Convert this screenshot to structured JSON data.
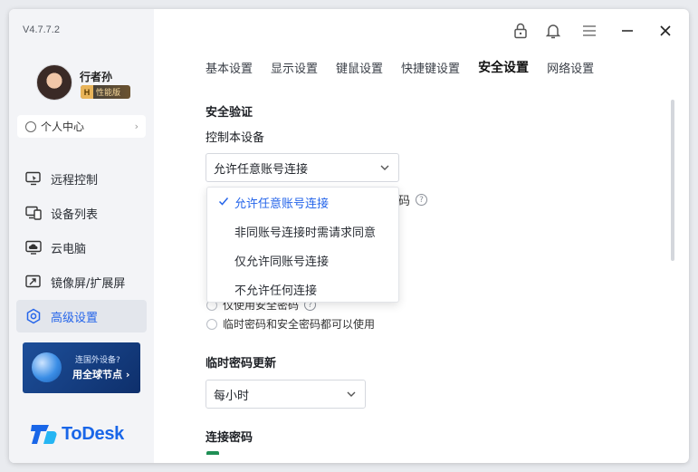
{
  "app": {
    "version": "V4.7.7.2",
    "brand": "ToDesk",
    "accent": "#2565ea"
  },
  "user": {
    "name": "行者孙",
    "badge_letter": "H",
    "badge_text": "性能版"
  },
  "personal_center": {
    "label": "个人中心"
  },
  "sidebar": {
    "items": [
      {
        "label": "远程控制",
        "icon": "remote-control-icon"
      },
      {
        "label": "设备列表",
        "icon": "device-list-icon"
      },
      {
        "label": "云电脑",
        "icon": "cloud-pc-icon"
      },
      {
        "label": "镜像屏/扩展屏",
        "icon": "mirror-screen-icon"
      },
      {
        "label": "高级设置",
        "icon": "advanced-settings-icon"
      }
    ]
  },
  "promo": {
    "line1": "连国外设备?",
    "line2": "用全球节点 ›"
  },
  "tabs": [
    {
      "label": "基本设置"
    },
    {
      "label": "显示设置"
    },
    {
      "label": "键鼠设置"
    },
    {
      "label": "快捷键设置"
    },
    {
      "label": "安全设置",
      "active": true
    },
    {
      "label": "网络设置"
    }
  ],
  "security": {
    "section_title": "安全验证",
    "control_label": "控制本设备",
    "control_value": "允许任意账号连接",
    "dropdown_options": [
      {
        "label": "允许任意账号连接",
        "selected": true
      },
      {
        "label": "非同账号连接时需请求同意"
      },
      {
        "label": "仅允许同账号连接"
      },
      {
        "label": "不允许任何连接"
      }
    ],
    "hidden_suffix": "码",
    "radio_partial": "仅使用安全密码",
    "radio_both": "临时密码和安全密码都可以使用"
  },
  "temp_password": {
    "title": "临时密码更新",
    "value": "每小时"
  },
  "connect_password": {
    "title": "连接密码"
  }
}
